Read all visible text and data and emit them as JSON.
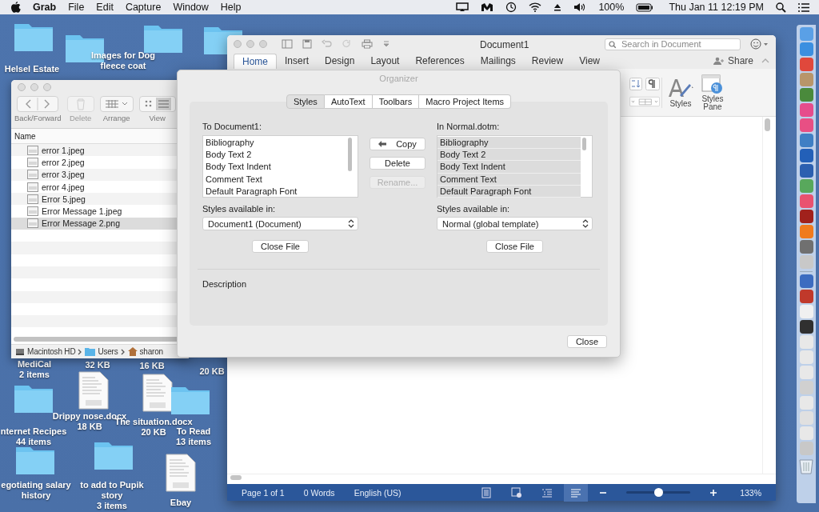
{
  "menu_bar": {
    "app": "Grab",
    "menus": [
      "File",
      "Edit",
      "Capture",
      "Window",
      "Help"
    ],
    "battery": "100%",
    "clock": "Thu Jan 11  12:19 PM"
  },
  "desktop_items": [
    {
      "kind": "folder",
      "name": "Helsel Estate"
    },
    {
      "kind": "folder",
      "name": "Images for Dog fleece coat"
    },
    {
      "kind": "label",
      "name": "MediCal",
      "detail": "2 items"
    },
    {
      "kind": "label",
      "detail": "32 KB"
    },
    {
      "kind": "label",
      "detail": "16 KB"
    },
    {
      "kind": "label",
      "detail": "20 KB"
    },
    {
      "kind": "document",
      "name": "Drippy nose.docx",
      "detail": "18 KB"
    },
    {
      "kind": "document",
      "name": "The situation.docx",
      "detail": "20 KB"
    },
    {
      "kind": "folder",
      "name": "nternet Recipes",
      "detail": "44 items"
    },
    {
      "kind": "folder",
      "name": "To Read",
      "detail": "13 items"
    },
    {
      "kind": "folder",
      "name": "egotiating salary history"
    },
    {
      "kind": "folder",
      "name": "to add to Pupik story",
      "detail": "3 items"
    },
    {
      "kind": "document",
      "name": "Ebay"
    }
  ],
  "finder": {
    "toolbar": [
      {
        "label": "Back/Forward",
        "disabled": false
      },
      {
        "label": "Delete",
        "disabled": true
      },
      {
        "label": "Arrange",
        "disabled": false
      },
      {
        "label": "View",
        "disabled": false
      }
    ],
    "column": "Name",
    "files": [
      {
        "name": "error 1.jpeg",
        "selected": false
      },
      {
        "name": "error 2.jpeg",
        "selected": false
      },
      {
        "name": "error 3.jpeg",
        "selected": false
      },
      {
        "name": "error 4.jpeg",
        "selected": false
      },
      {
        "name": "Error 5.jpeg",
        "selected": false
      },
      {
        "name": "Error Message 1.jpeg",
        "selected": false
      },
      {
        "name": "Error Message 2.png",
        "selected": true
      }
    ],
    "path": [
      "Macintosh HD",
      "Users",
      "sharon"
    ]
  },
  "word": {
    "title": "Document1",
    "search": {
      "placeholder": "Search in Document"
    },
    "tabs": [
      {
        "label": "Home",
        "selected": true
      },
      {
        "label": "Insert",
        "selected": false
      },
      {
        "label": "Design",
        "selected": false
      },
      {
        "label": "Layout",
        "selected": false
      },
      {
        "label": "References",
        "selected": false
      },
      {
        "label": "Mailings",
        "selected": false
      },
      {
        "label": "Review",
        "selected": false
      },
      {
        "label": "View",
        "selected": false
      }
    ],
    "share": "Share",
    "ribbon": [
      "Styles",
      "Styles Pane"
    ],
    "status": {
      "page": "Page 1 of 1",
      "words": "0 Words",
      "language": "English (US)",
      "zoom": {
        "level": 0.5
      },
      "zoom_reading": "133%"
    }
  },
  "organizer": {
    "title": "Organizer",
    "tabs": [
      {
        "label": "Styles",
        "selected": true
      },
      {
        "label": "AutoText",
        "selected": false
      },
      {
        "label": "Toolbars",
        "selected": false
      },
      {
        "label": "Macro Project Items",
        "selected": false
      }
    ],
    "left": {
      "heading": "To Document1:",
      "styles": [
        {
          "name": "Bibliography",
          "selected": false
        },
        {
          "name": "Body Text 2",
          "selected": false
        },
        {
          "name": "Body Text Indent",
          "selected": false
        },
        {
          "name": "Comment Text",
          "selected": false
        },
        {
          "name": "Default Paragraph Font",
          "selected": false
        }
      ],
      "available_label": "Styles available in:",
      "available": "Document1 (Document)",
      "close_file": "Close File"
    },
    "actions": [
      {
        "label": "Copy",
        "disabled": false,
        "arrow": true
      },
      {
        "label": "Delete",
        "disabled": false,
        "arrow": false
      },
      {
        "label": "Rename...",
        "disabled": true,
        "arrow": false
      }
    ],
    "right": {
      "heading": "In Normal.dotm:",
      "styles": [
        {
          "name": "Bibliography",
          "selected": true
        },
        {
          "name": "Body Text 2",
          "selected": true
        },
        {
          "name": "Body Text Indent",
          "selected": true
        },
        {
          "name": "Comment Text",
          "selected": true
        },
        {
          "name": "Default Paragraph Font",
          "selected": true
        }
      ],
      "available_label": "Styles available in:",
      "available": "Normal (global template)",
      "close_file": "Close File"
    },
    "description": "Description",
    "close": "Close"
  }
}
